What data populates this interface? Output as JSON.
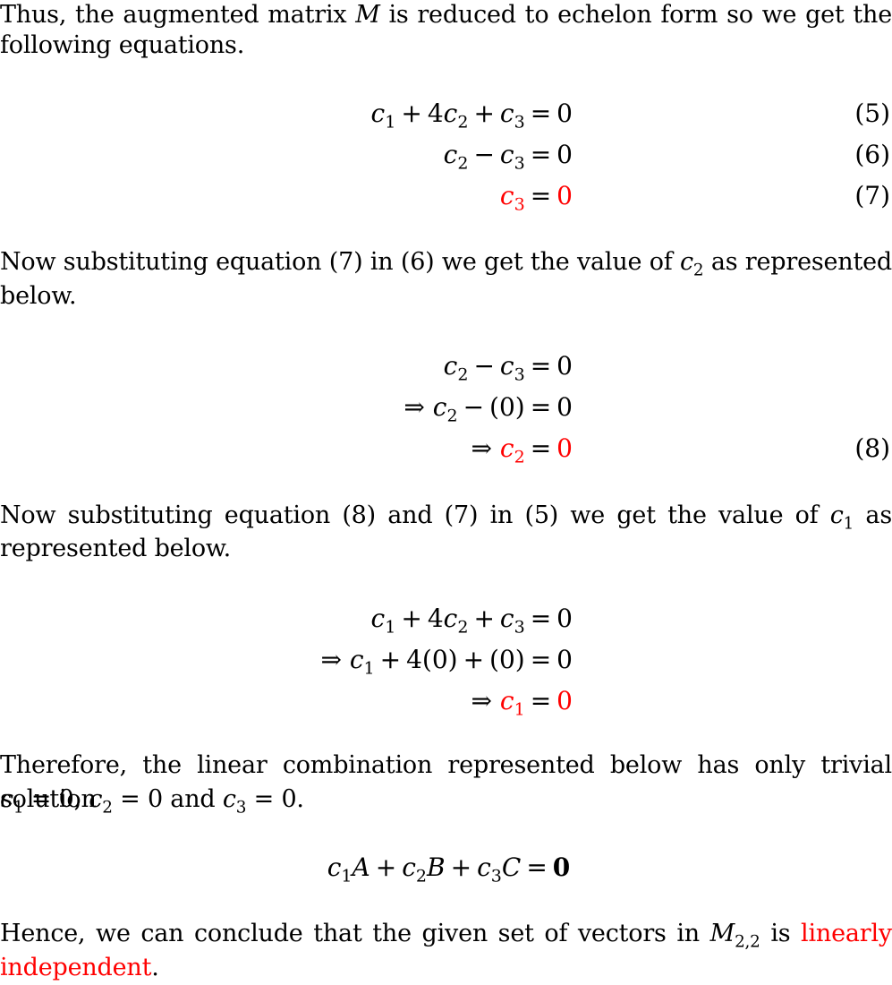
{
  "paragraphs": {
    "p1": {
      "line1": "Thus, the augmented matrix M is reduced to echelon form so we get the",
      "line2": "following equations."
    },
    "p2": {
      "text_before": "Now substituting equation (7) in (6) we get the value of",
      "var": "c",
      "var_sub": "2",
      "text_after": "as represented",
      "line2": "below."
    },
    "p3": {
      "text_before": "Now substituting equation (8) and (7) in (5) we get the value of",
      "var": "c",
      "var_sub": "1",
      "text_after": "as",
      "line2": "represented below."
    },
    "p4": {
      "line1": "Therefore, the linear combination represented below has only trivial solution",
      "line2": "c₁ = 0, c₂ = 0 and c₃ = 0."
    },
    "p5": {
      "text_before": "Hence, we can conclude that the given set of vectors in",
      "space": "M",
      "space_sub": "2,2",
      "is": "is",
      "highlight_line1": "linearly",
      "highlight_line2": "independent",
      "end": "."
    }
  },
  "equations": {
    "system": [
      {
        "lhs": "c₁ + 4c₂ + c₃",
        "rhs": "0",
        "number": "(5)",
        "highlight": false
      },
      {
        "lhs": "c₂ − c₃",
        "rhs": "0",
        "number": "(6)",
        "highlight": false
      },
      {
        "lhs": "c₃",
        "rhs": "0",
        "number": "(7)",
        "highlight": true
      }
    ],
    "solve_c2": [
      {
        "lhs": "c₂ − c₃",
        "rhs": "0",
        "number": ""
      },
      {
        "lhs": "⇒ c₂ − (0)",
        "rhs": "0",
        "number": ""
      },
      {
        "lhs": "⇒ c₂",
        "rhs": "0",
        "number": "(8)",
        "highlight": true
      }
    ],
    "solve_c1": [
      {
        "lhs": "c₁ + 4c₂ + c₃",
        "rhs": "0",
        "number": ""
      },
      {
        "lhs": "⇒ c₁ + 4(0) + (0)",
        "rhs": "0",
        "number": ""
      },
      {
        "lhs": "⇒ c₁",
        "rhs": "0",
        "number": "",
        "highlight": true
      }
    ],
    "linear_combination": {
      "lhs": "c₁A + c₂B + c₃C",
      "rhs": "0"
    }
  },
  "colors": {
    "highlight": "#ff0000",
    "text": "#000000",
    "background": "#ffffff"
  }
}
